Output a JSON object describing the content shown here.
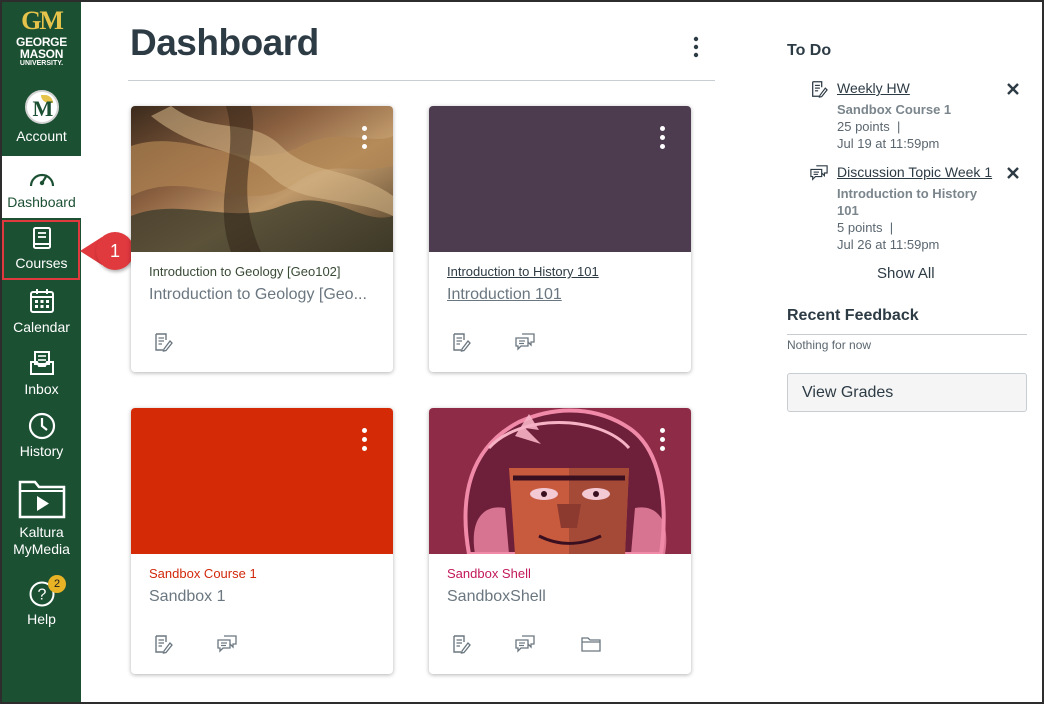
{
  "global_nav": {
    "logo": {
      "monogram": "GM",
      "line1": "GEORGE",
      "line2": "MASON",
      "line3": "UNIVERSITY."
    },
    "items": [
      {
        "label": "Account",
        "icon": "avatar"
      },
      {
        "label": "Dashboard",
        "icon": "dashboard-gauge-icon"
      },
      {
        "label": "Courses",
        "icon": "book-icon"
      },
      {
        "label": "Calendar",
        "icon": "calendar-icon"
      },
      {
        "label": "Inbox",
        "icon": "inbox-icon"
      },
      {
        "label": "History",
        "icon": "clock-icon"
      },
      {
        "label": "Kaltura MyMedia",
        "icon": "folder-play-icon"
      },
      {
        "label": "Help",
        "icon": "question-icon",
        "badge": "2"
      }
    ],
    "active": "Dashboard",
    "highlighted": "Courses"
  },
  "callout": {
    "number": "1",
    "color": "#e0393e"
  },
  "header": {
    "title": "Dashboard"
  },
  "cards": [
    {
      "title": "Introduction to Geology [Geo102]",
      "subtitle": "Introduction to Geology [Geo...",
      "title_color": "#394b35",
      "hero": "canyon-image",
      "icons": [
        "assignments-icon"
      ]
    },
    {
      "title": "Introduction to History 101",
      "subtitle": "Introduction 101",
      "title_color": "#2d3b45",
      "hero_color": "#4d3b4f",
      "icons": [
        "assignments-icon",
        "discussions-icon"
      ]
    },
    {
      "title": "Sandbox Course 1",
      "subtitle": "Sandbox 1",
      "title_color": "#d2290c",
      "hero_color": "#d42a06",
      "icons": [
        "assignments-icon",
        "discussions-icon"
      ]
    },
    {
      "title": "Sandbox Shell",
      "subtitle": "SandboxShell",
      "title_color": "#c3195b",
      "hero_color": "#8e2c48",
      "hero": "patriot-mascot-image",
      "icons": [
        "assignments-icon",
        "discussions-icon",
        "files-icon"
      ]
    }
  ],
  "todo": {
    "heading": "To Do",
    "items": [
      {
        "title": "Weekly HW",
        "course": "Sandbox Course 1",
        "points": "25 points",
        "due": "Jul 19 at 11:59pm",
        "icon": "assignment-icon"
      },
      {
        "title": "Discussion Topic Week 1",
        "course": "Introduction to History 101",
        "points": "5 points",
        "due": "Jul 26 at 11:59pm",
        "icon": "discussion-icon"
      }
    ],
    "show_all": "Show All"
  },
  "recent_feedback": {
    "heading": "Recent Feedback",
    "empty": "Nothing for now"
  },
  "view_grades": "View Grades"
}
